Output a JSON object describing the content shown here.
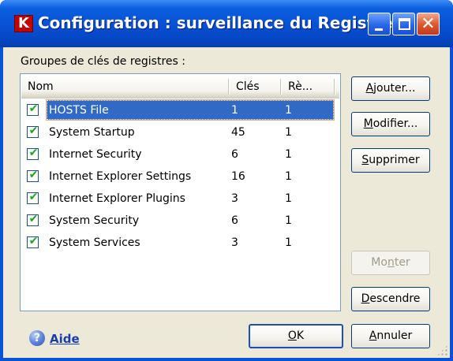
{
  "window": {
    "title": "Configuration : surveillance du Registre",
    "close_glyph": "✕"
  },
  "groups": {
    "label": "Groupes de clés de registres :",
    "columns": {
      "name": "Nom",
      "keys": "Clés",
      "rules": "Rè..."
    },
    "rows": [
      {
        "name": "HOSTS File",
        "keys": "1",
        "rules": "1",
        "checked": true,
        "selected": true
      },
      {
        "name": "System Startup",
        "keys": "45",
        "rules": "1",
        "checked": true
      },
      {
        "name": "Internet Security",
        "keys": "6",
        "rules": "1",
        "checked": true
      },
      {
        "name": "Internet Explorer Settings",
        "keys": "16",
        "rules": "1",
        "checked": true
      },
      {
        "name": "Internet Explorer Plugins",
        "keys": "3",
        "rules": "1",
        "checked": true
      },
      {
        "name": "System Security",
        "keys": "6",
        "rules": "1",
        "checked": true
      },
      {
        "name": "System Services",
        "keys": "3",
        "rules": "1",
        "checked": true
      }
    ]
  },
  "buttons": {
    "add": {
      "pre": "",
      "mn": "A",
      "post": "jouter..."
    },
    "modify": {
      "pre": "",
      "mn": "M",
      "post": "odifier..."
    },
    "delete": {
      "pre": "",
      "mn": "S",
      "post": "upprimer"
    },
    "up": {
      "pre": "Mo",
      "mn": "n",
      "post": "ter"
    },
    "down": {
      "pre": "",
      "mn": "D",
      "post": "escendre"
    },
    "ok": {
      "pre": "",
      "mn": "O",
      "post": "K"
    },
    "cancel": {
      "pre": "",
      "mn": "A",
      "post": "nnuler"
    }
  },
  "help": {
    "label": "Aide",
    "icon_glyph": "?"
  },
  "check_glyph": "✔",
  "colors": {
    "titlebar": "#0852d5",
    "selection": "#316ac5",
    "checkmark": "#21a121",
    "link": "#1a3ea8",
    "face": "#ece9d8"
  }
}
